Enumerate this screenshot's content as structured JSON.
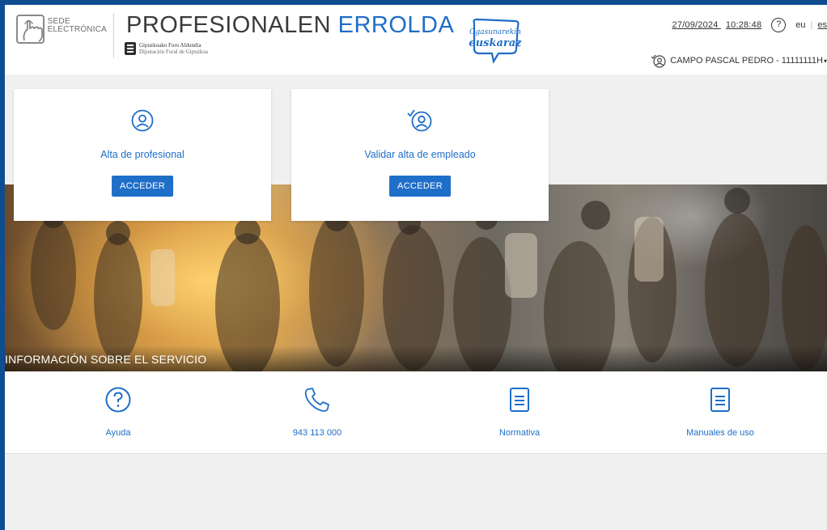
{
  "header": {
    "sede_line1": "SEDE",
    "sede_line2": "ELECTRÓNICA",
    "title_part1": "PROFESIONALEN",
    "title_part2": "ERROLDA",
    "org_line1": "Gipuzkoako Foru Aldundia",
    "org_line2": "Diputación Foral de Gipuzkoa",
    "badge_line1": "Ogasunarekin",
    "badge_line2": "euskaraz",
    "date": "27/09/2024",
    "time": "10:28:48",
    "help_glyph": "?",
    "lang_eu": "eu",
    "lang_sep": "|",
    "lang_es": "es",
    "user": "CAMPO PASCAL PEDRO - 11111111H",
    "user_caret": "▾"
  },
  "cards": [
    {
      "title": "Alta de profesional",
      "button": "ACCEDER",
      "icon": "user-circle-icon"
    },
    {
      "title": "Validar alta de empleado",
      "button": "ACCEDER",
      "icon": "user-check-icon"
    }
  ],
  "hero": {
    "caption": "INFORMACIÓN SOBRE EL SERVICIO"
  },
  "info": [
    {
      "label": "Ayuda",
      "icon": "help-icon"
    },
    {
      "label": "943 113 000",
      "icon": "phone-icon"
    },
    {
      "label": "Normativa",
      "icon": "document-icon"
    },
    {
      "label": "Manuales de uso",
      "icon": "document-icon"
    }
  ],
  "colors": {
    "brand_blue": "#1f6ec8",
    "frame_blue": "#0f4d91",
    "page_bg": "#f0f0f0"
  }
}
